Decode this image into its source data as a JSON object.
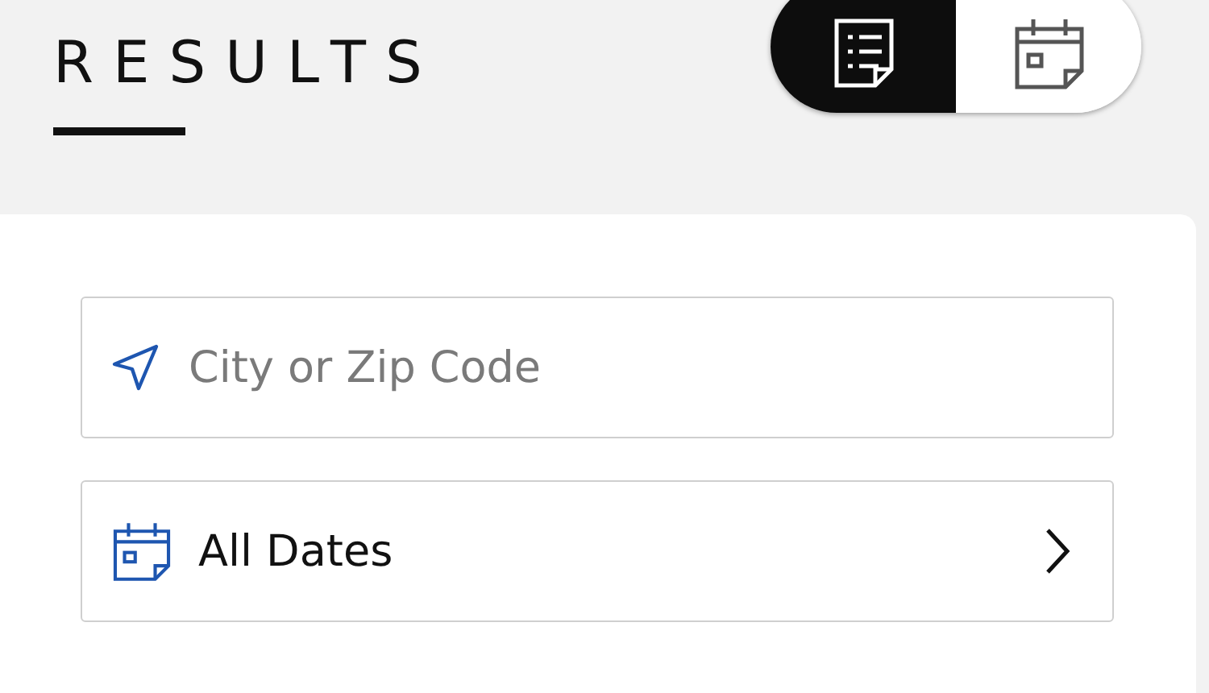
{
  "title": "RESULTS",
  "view_toggle": [
    {
      "kind": "list",
      "selected": true
    },
    {
      "kind": "calendar",
      "selected": false
    }
  ],
  "location_field": {
    "placeholder": "City or Zip Code"
  },
  "date_picker": {
    "value": "All Dates"
  }
}
